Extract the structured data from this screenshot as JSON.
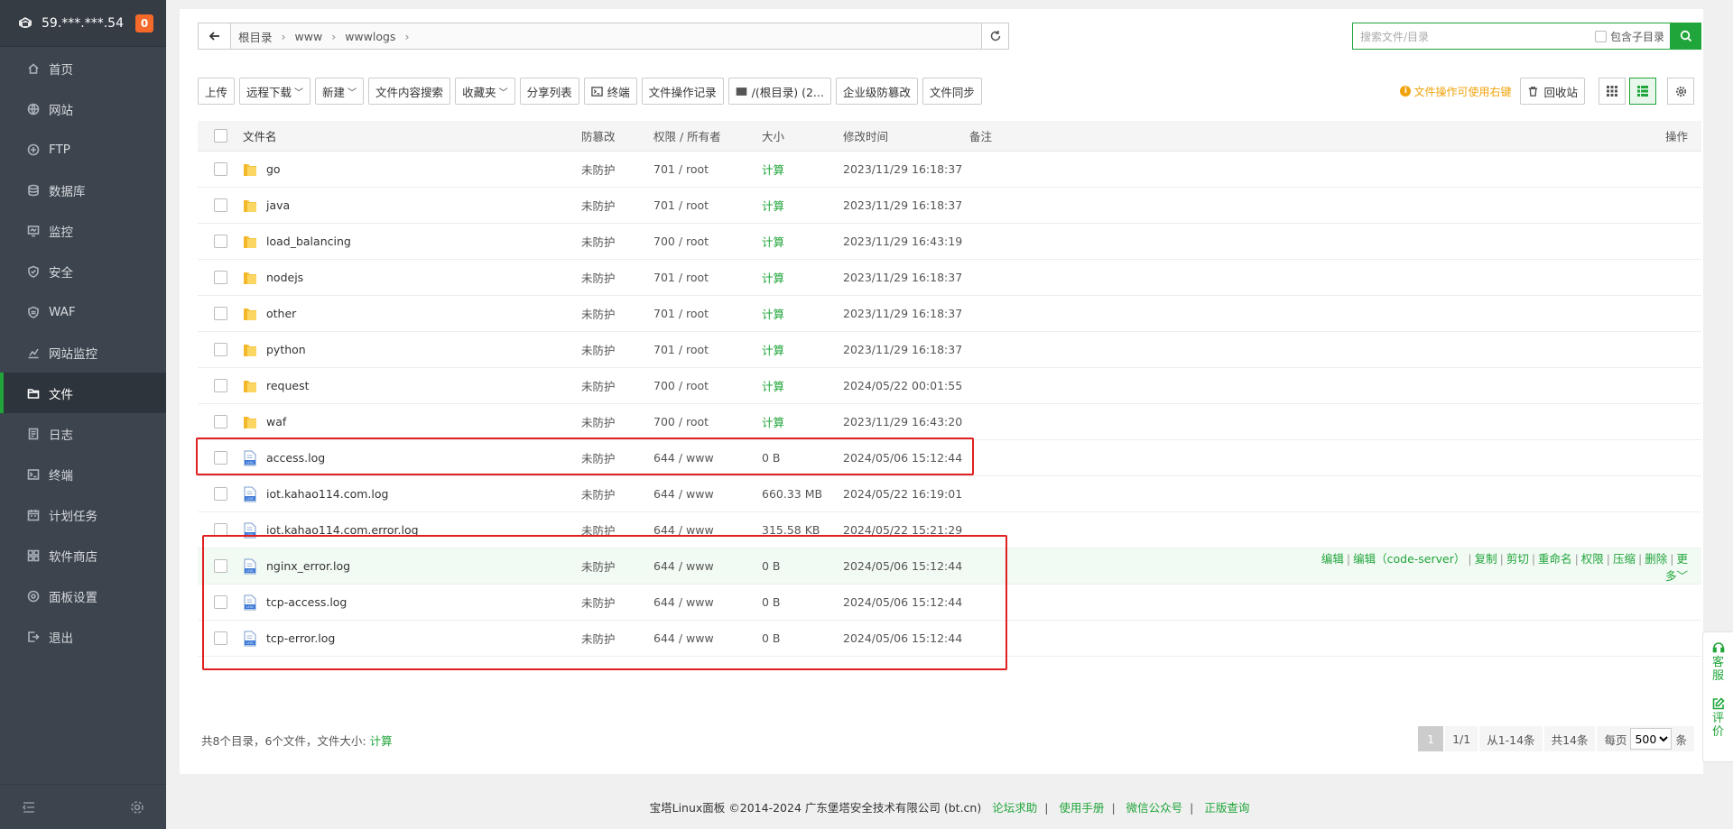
{
  "sidebar": {
    "ip": "59.***.***.54",
    "badge": "0",
    "items": [
      {
        "label": "首页",
        "icon": "home-icon"
      },
      {
        "label": "网站",
        "icon": "globe-icon"
      },
      {
        "label": "FTP",
        "icon": "ftp-icon"
      },
      {
        "label": "数据库",
        "icon": "database-icon"
      },
      {
        "label": "监控",
        "icon": "monitor-icon"
      },
      {
        "label": "安全",
        "icon": "shield-icon"
      },
      {
        "label": "WAF",
        "icon": "waf-icon"
      },
      {
        "label": "网站监控",
        "icon": "chart-icon"
      },
      {
        "label": "文件",
        "icon": "folder-icon",
        "active": true
      },
      {
        "label": "日志",
        "icon": "log-icon"
      },
      {
        "label": "终端",
        "icon": "terminal-icon"
      },
      {
        "label": "计划任务",
        "icon": "calendar-icon"
      },
      {
        "label": "软件商店",
        "icon": "apps-icon"
      },
      {
        "label": "面板设置",
        "icon": "settings-icon"
      },
      {
        "label": "退出",
        "icon": "logout-icon"
      }
    ]
  },
  "path": {
    "crumbs": [
      "根目录",
      "www",
      "wwwlogs"
    ]
  },
  "search": {
    "placeholder": "搜索文件/目录",
    "include_sub": "包含子目录"
  },
  "toolbar": {
    "upload": "上传",
    "remote_download": "远程下载",
    "new": "新建",
    "content_search": "文件内容搜索",
    "favorites": "收藏夹",
    "share_list": "分享列表",
    "terminal": "终端",
    "op_log": "文件操作记录",
    "disk": "/(根目录) (2...",
    "tamper": "企业级防篡改",
    "sync": "文件同步",
    "tip": "文件操作可使用右键",
    "recycle": "回收站"
  },
  "table": {
    "headers": {
      "name": "文件名",
      "tamper": "防篡改",
      "perm": "权限 / 所有者",
      "size": "大小",
      "mtime": "修改时间",
      "note": "备注",
      "ops": "操作"
    },
    "rows": [
      {
        "name": "go",
        "type": "folder",
        "tamper": "未防护",
        "perm": "701 / root",
        "size": "计算",
        "mtime": "2023/11/29 16:18:37"
      },
      {
        "name": "java",
        "type": "folder",
        "tamper": "未防护",
        "perm": "701 / root",
        "size": "计算",
        "mtime": "2023/11/29 16:18:37"
      },
      {
        "name": "load_balancing",
        "type": "folder",
        "tamper": "未防护",
        "perm": "700 / root",
        "size": "计算",
        "mtime": "2023/11/29 16:43:19"
      },
      {
        "name": "nodejs",
        "type": "folder",
        "tamper": "未防护",
        "perm": "701 / root",
        "size": "计算",
        "mtime": "2023/11/29 16:18:37"
      },
      {
        "name": "other",
        "type": "folder",
        "tamper": "未防护",
        "perm": "701 / root",
        "size": "计算",
        "mtime": "2023/11/29 16:18:37"
      },
      {
        "name": "python",
        "type": "folder",
        "tamper": "未防护",
        "perm": "701 / root",
        "size": "计算",
        "mtime": "2023/11/29 16:18:37"
      },
      {
        "name": "request",
        "type": "folder",
        "tamper": "未防护",
        "perm": "700 / root",
        "size": "计算",
        "mtime": "2024/05/22 00:01:55"
      },
      {
        "name": "waf",
        "type": "folder",
        "tamper": "未防护",
        "perm": "700 / root",
        "size": "计算",
        "mtime": "2023/11/29 16:43:20"
      },
      {
        "name": "access.log",
        "type": "file",
        "tamper": "未防护",
        "perm": "644 / www",
        "size": "0 B",
        "mtime": "2024/05/06 15:12:44"
      },
      {
        "name": "iot.kahao114.com.log",
        "type": "file",
        "tamper": "未防护",
        "perm": "644 / www",
        "size": "660.33 MB",
        "mtime": "2024/05/22 16:19:01"
      },
      {
        "name": "iot.kahao114.com.error.log",
        "type": "file",
        "tamper": "未防护",
        "perm": "644 / www",
        "size": "315.58 KB",
        "mtime": "2024/05/22 15:21:29"
      },
      {
        "name": "nginx_error.log",
        "type": "file",
        "tamper": "未防护",
        "perm": "644 / www",
        "size": "0 B",
        "mtime": "2024/05/06 15:12:44",
        "hover": true
      },
      {
        "name": "tcp-access.log",
        "type": "file",
        "tamper": "未防护",
        "perm": "644 / www",
        "size": "0 B",
        "mtime": "2024/05/06 15:12:44"
      },
      {
        "name": "tcp-error.log",
        "type": "file",
        "tamper": "未防护",
        "perm": "644 / www",
        "size": "0 B",
        "mtime": "2024/05/06 15:12:44"
      }
    ],
    "row_ops": [
      "编辑",
      "编辑（code-server）",
      "复制",
      "剪切",
      "重命名",
      "权限",
      "压缩",
      "删除",
      "更多"
    ]
  },
  "summary": {
    "text": "共8个目录，6个文件，文件大小:",
    "calc": "计算"
  },
  "pager": {
    "current": "1",
    "pages": "1/1",
    "range": "从1-14条",
    "total": "共14条",
    "per_page_label": "每页",
    "per_page": "500",
    "unit": "条"
  },
  "copyright": {
    "text": "宝塔Linux面板 ©2014-2024 广东堡塔安全技术有限公司 (bt.cn)",
    "links": [
      "论坛求助",
      "使用手册",
      "微信公众号",
      "正版查询"
    ]
  },
  "float": {
    "service": [
      "客",
      "服"
    ],
    "review": [
      "评",
      "价"
    ]
  },
  "colors": {
    "accent": "#20a53a",
    "sidebar": "#3c444d",
    "annotation": "#e02020"
  }
}
